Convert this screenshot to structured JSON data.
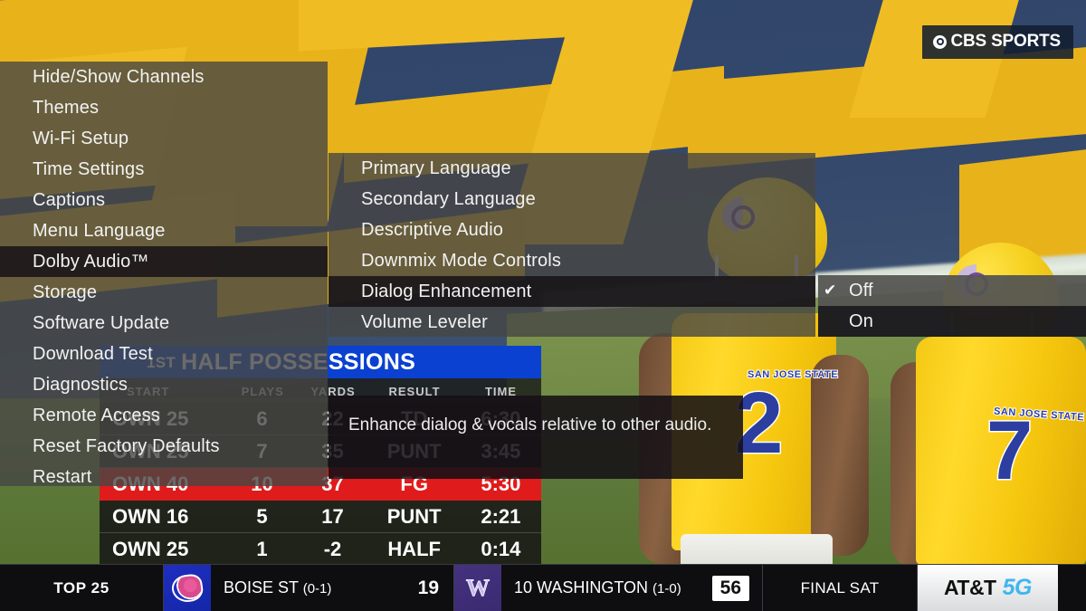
{
  "broadcast": {
    "network_bug": {
      "name": "CBS SPORTS",
      "icon": "cbs-eye-icon"
    },
    "players": [
      {
        "team": "SAN JOSE STATE",
        "number": "2"
      },
      {
        "team": "SAN JOSE STATE",
        "number": "7"
      }
    ]
  },
  "possessions": {
    "title_prefix": "1ST",
    "title": "HALF POSSESSIONS",
    "columns": [
      "START",
      "PLAYS",
      "YARDS",
      "RESULT",
      "TIME"
    ],
    "rows": [
      {
        "start": "OWN 25",
        "plays": "6",
        "yards": "22",
        "result": "TD",
        "time": "6:30",
        "highlight": false
      },
      {
        "start": "OWN 25",
        "plays": "7",
        "yards": "35",
        "result": "PUNT",
        "time": "3:45",
        "highlight": false
      },
      {
        "start": "OWN 40",
        "plays": "10",
        "yards": "37",
        "result": "FG",
        "time": "5:30",
        "highlight": true
      },
      {
        "start": "OWN 16",
        "plays": "5",
        "yards": "17",
        "result": "PUNT",
        "time": "2:21",
        "highlight": false
      },
      {
        "start": "OWN 25",
        "plays": "1",
        "yards": "-2",
        "result": "HALF",
        "time": "0:14",
        "highlight": false
      }
    ]
  },
  "ticker": {
    "label": "TOP 25",
    "games": [
      {
        "logo": "boise-state-bronco-icon",
        "team": "BOISE ST",
        "record": "(0-1)",
        "score": "19",
        "boxed": false
      },
      {
        "logo": "washington-w-icon",
        "team": "10 WASHINGTON",
        "record": "(1-0)",
        "score": "56",
        "boxed": true
      }
    ],
    "status": "FINAL SAT",
    "sponsor": {
      "brand": "AT&T",
      "product": "5G"
    }
  },
  "settings": {
    "panel1": {
      "items": [
        {
          "label": "Hide/Show Channels",
          "selected": false
        },
        {
          "label": "Themes",
          "selected": false
        },
        {
          "label": "Wi-Fi Setup",
          "selected": false
        },
        {
          "label": "Time Settings",
          "selected": false
        },
        {
          "label": "Captions",
          "selected": false
        },
        {
          "label": "Menu Language",
          "selected": false
        },
        {
          "label": "Dolby Audio™",
          "selected": true
        },
        {
          "label": "Storage",
          "selected": false
        },
        {
          "label": "Software Update",
          "selected": false
        },
        {
          "label": "Download Test",
          "selected": false
        },
        {
          "label": "Diagnostics",
          "selected": false
        },
        {
          "label": "Remote Access",
          "selected": false
        },
        {
          "label": "Reset Factory Defaults",
          "selected": false
        },
        {
          "label": "Restart",
          "selected": false
        }
      ]
    },
    "panel2": {
      "items": [
        {
          "label": "Primary Language",
          "selected": false
        },
        {
          "label": "Secondary Language",
          "selected": false
        },
        {
          "label": "Descriptive Audio",
          "selected": false
        },
        {
          "label": "Downmix Mode Controls",
          "selected": false
        },
        {
          "label": "Dialog Enhancement",
          "selected": true
        },
        {
          "label": "Volume Leveler",
          "selected": false
        }
      ]
    },
    "panel3": {
      "options": [
        {
          "label": "Off",
          "checked": true,
          "icon": "checkmark-icon"
        },
        {
          "label": "On",
          "checked": false,
          "icon": ""
        }
      ],
      "check_glyph": "✔"
    },
    "tooltip": "Enhance dialog & vocals relative to other audio."
  }
}
